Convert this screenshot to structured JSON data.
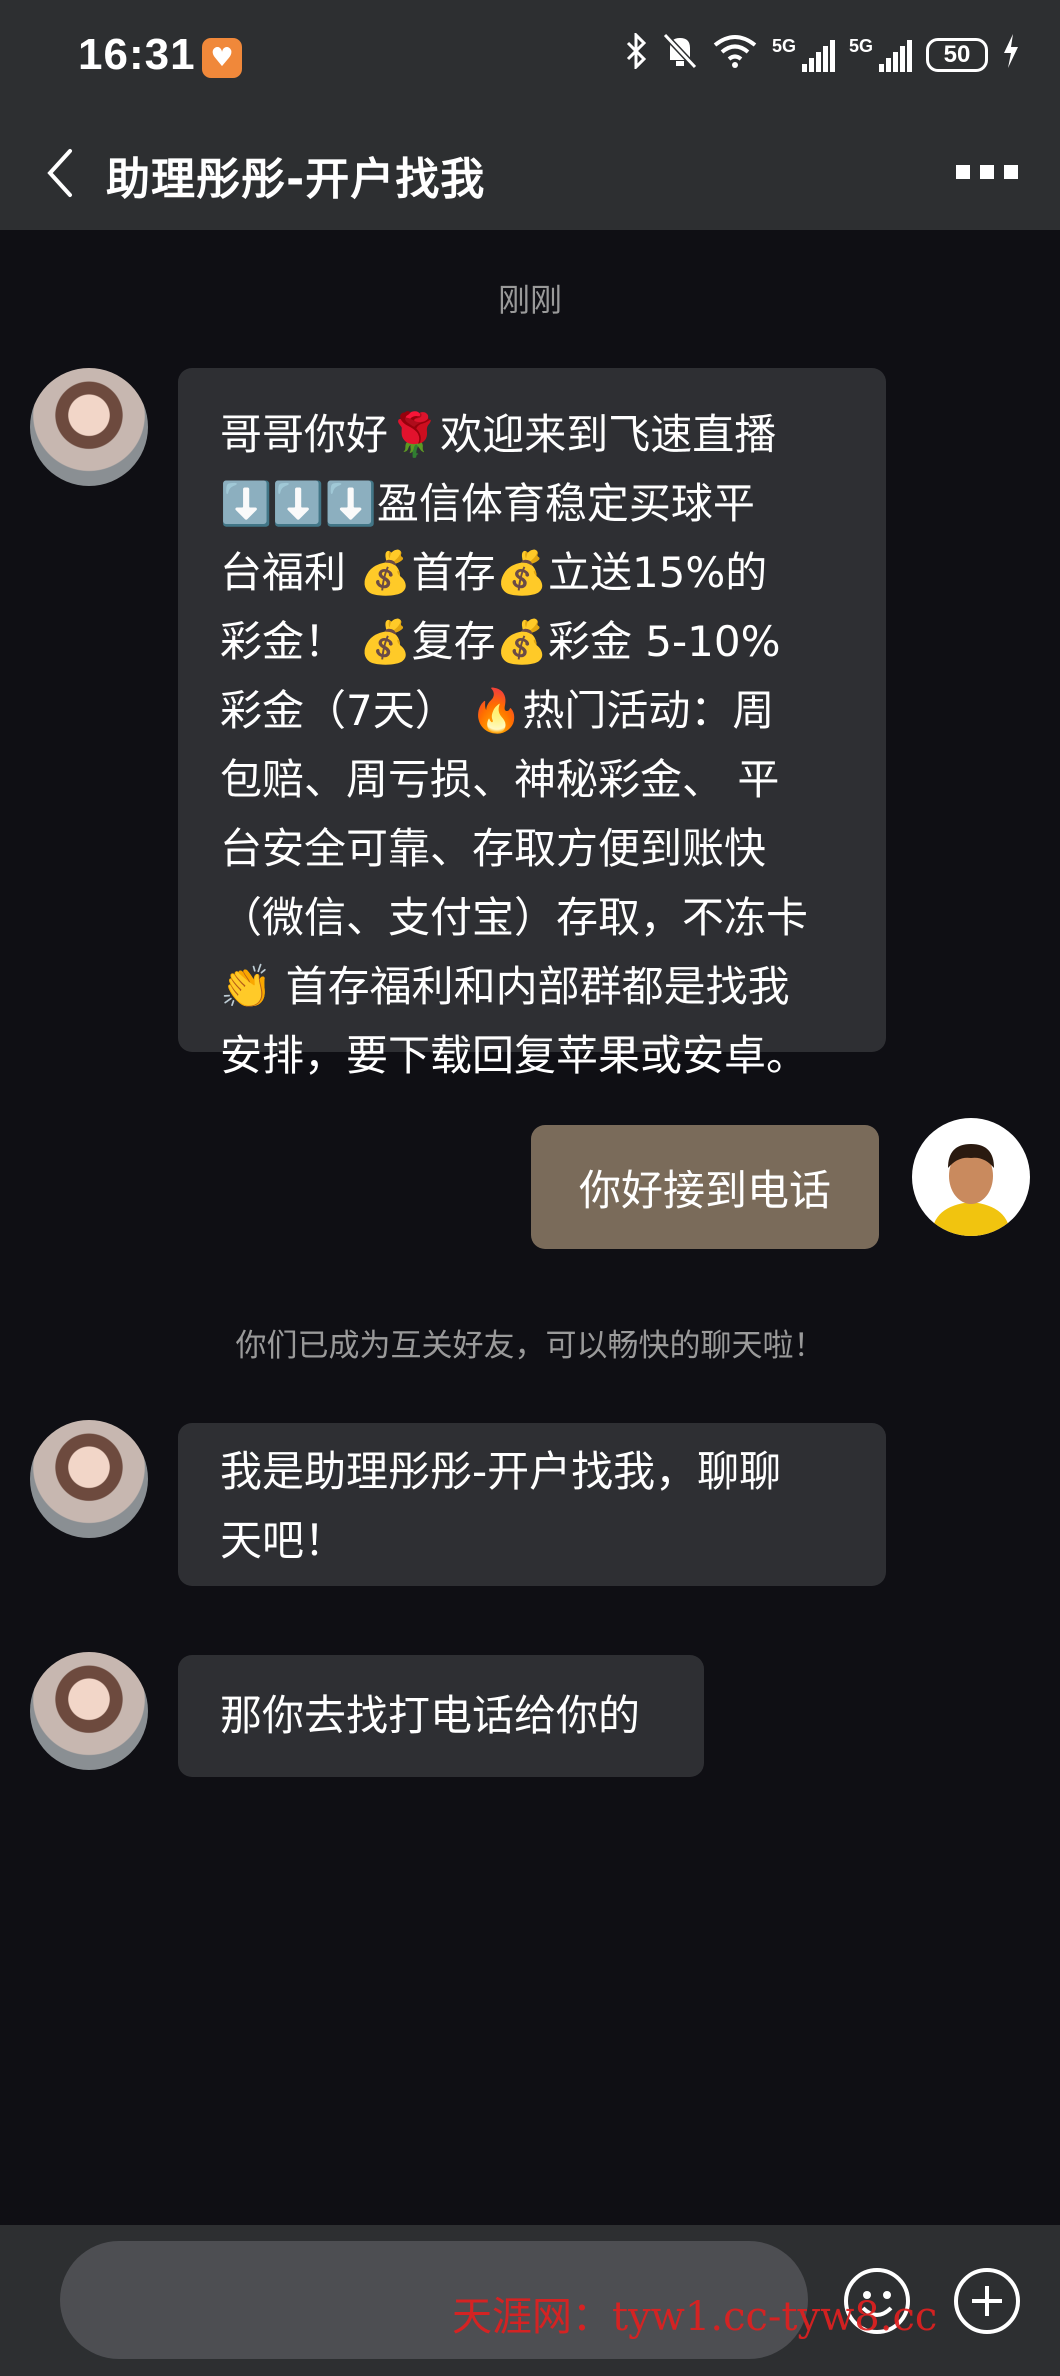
{
  "status_bar": {
    "time": "16:31",
    "battery": "50",
    "signal_label_1": "5G",
    "signal_label_2": "5G",
    "icons": [
      "heart-app-icon",
      "bluetooth-icon",
      "mute-icon",
      "wifi-icon",
      "signal-icon",
      "signal-icon",
      "battery-icon",
      "charging-icon"
    ]
  },
  "header": {
    "title": "助理彤彤-开户找我",
    "back_icon": "back-chevron-icon",
    "more_icon": "more-dots-icon"
  },
  "conversation": {
    "time_divider": "刚刚",
    "friend_notice": "你们已成为互关好友，可以畅快的聊天啦！",
    "messages": [
      {
        "sender": "other",
        "text": "哥哥你好🌹欢迎来到飞速直播\n⬇️⬇️⬇️盈信体育稳定买球平\n台福利 💰首存💰立送15%的\n彩金！ 💰复存💰彩金 5-10%\n彩金（7天） 🔥热门活动：周\n包赔、周亏损、神秘彩金、 平\n台安全可靠、存取方便到账快\n（微信、支付宝）存取，不冻卡\n👏 首存福利和内部群都是找我\n安排，要下载回复苹果或安卓。"
      },
      {
        "sender": "self",
        "text": "你好接到电话"
      },
      {
        "sender": "other",
        "text": "我是助理彤彤-开户找我，聊聊\n天吧！"
      },
      {
        "sender": "other",
        "text": "那你去找打电话给你的"
      }
    ]
  },
  "input_bar": {
    "placeholder": "",
    "emoji_icon": "emoji-smile-icon",
    "plus_icon": "plus-circle-icon"
  },
  "watermark": "天涯网：tyw1.cc-tyw8.cc",
  "colors": {
    "background": "#0f0f14",
    "bar": "#2d2f31",
    "bubble_other": "#2e2f33",
    "bubble_self": "#7a6b5a",
    "watermark": "#e02020"
  }
}
